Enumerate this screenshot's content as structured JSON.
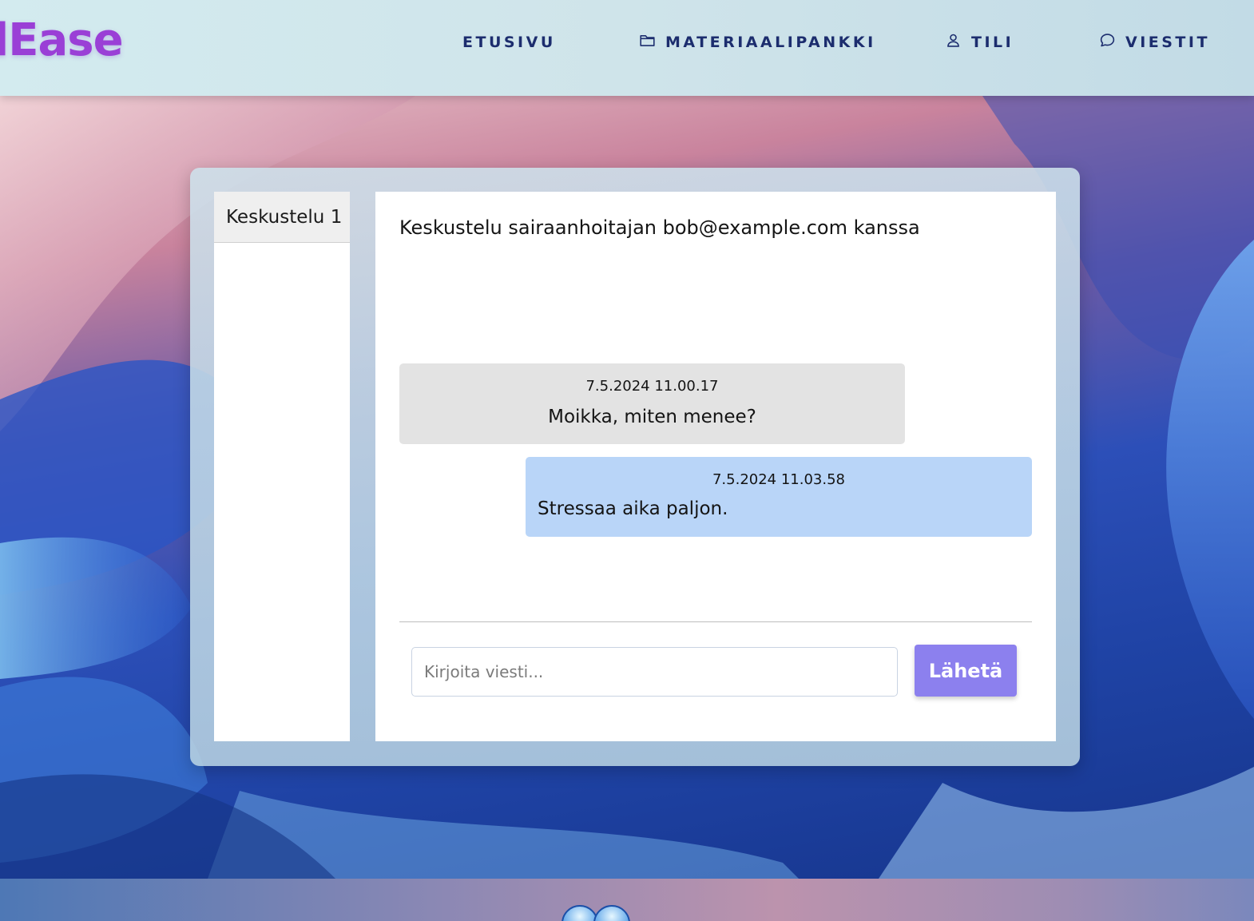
{
  "header": {
    "logo_text": "lEase",
    "nav": [
      {
        "label": "ETUSIVU",
        "icon": ""
      },
      {
        "label": "MATERIAALIPANKKI",
        "icon": "folder-icon"
      },
      {
        "label": "TILI",
        "icon": "user-icon"
      },
      {
        "label": "VIESTIT",
        "icon": "chat-bubble-icon"
      }
    ]
  },
  "sidebar": {
    "conversations": [
      {
        "label": "Keskustelu 1"
      }
    ]
  },
  "chat": {
    "title": "Keskustelu sairaanhoitajan bob@example.com kanssa",
    "messages": [
      {
        "time": "7.5.2024 11.00.17",
        "text": "Moikka, miten menee?",
        "direction": "incoming"
      },
      {
        "time": "7.5.2024 11.03.58",
        "text": "Stressaa aika paljon.",
        "direction": "outgoing"
      }
    ],
    "input": {
      "placeholder": "Kirjoita viesti...",
      "value": ""
    },
    "send_label": "Lähetä"
  },
  "colors": {
    "accent": "#8c80ee",
    "logo": "#9a3fd6",
    "nav_text": "#1c2d6e",
    "incoming_bubble": "#e3e3e3",
    "outgoing_bubble": "#b9d5f8"
  }
}
